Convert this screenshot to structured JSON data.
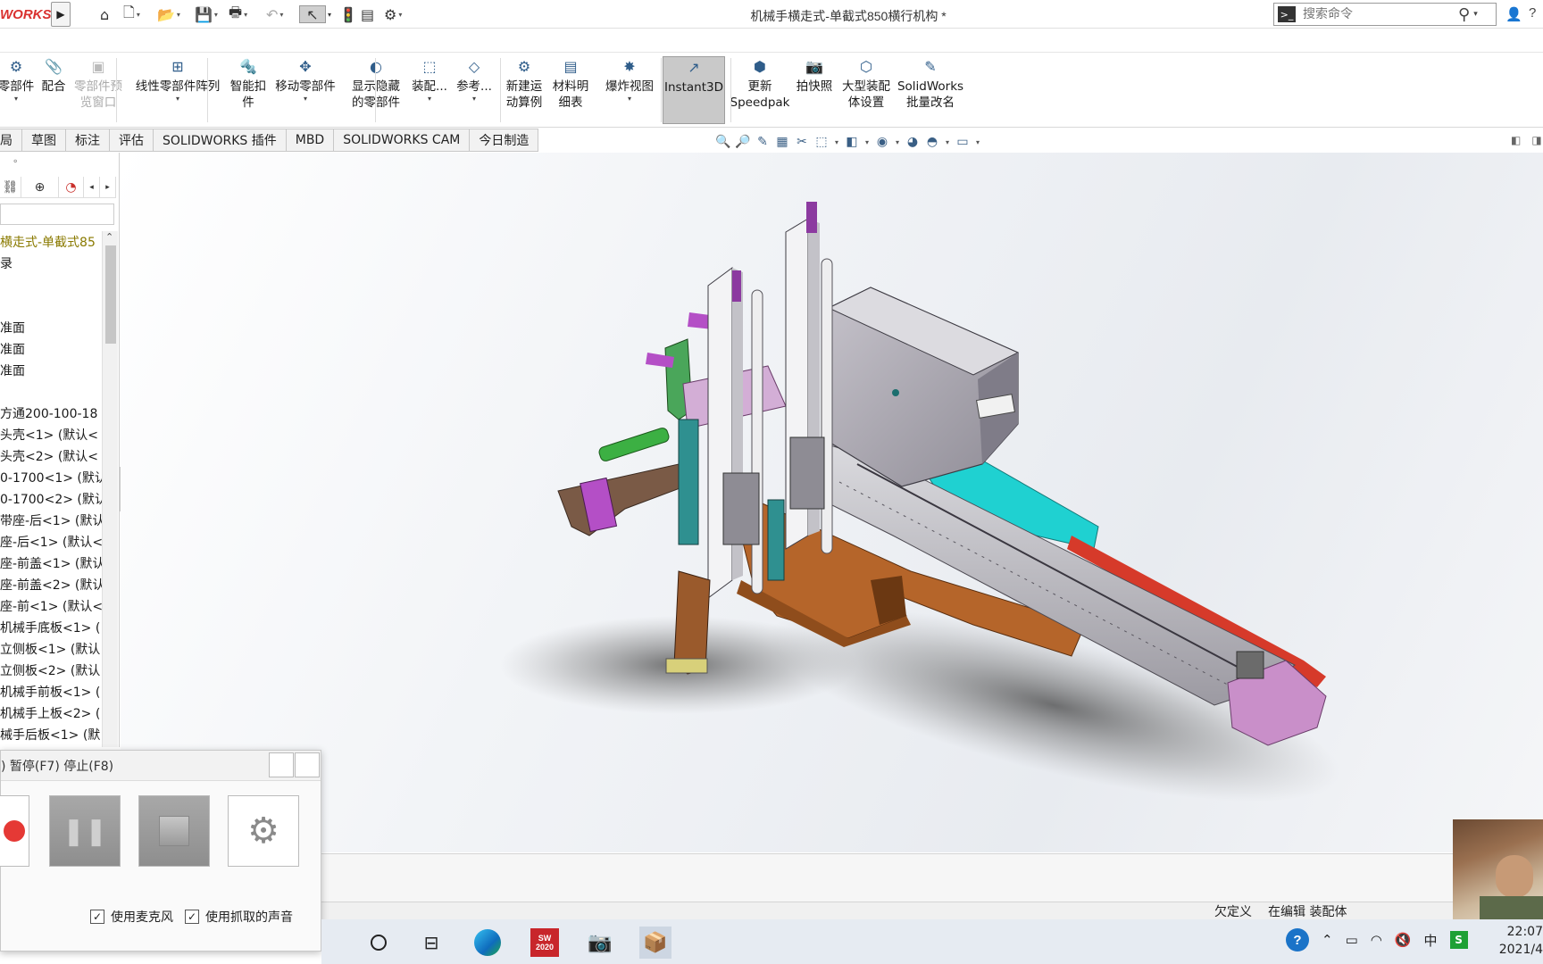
{
  "app": {
    "logo_text": "WORKS",
    "document_title": "机械手横走式-单截式850横行机构 *",
    "search_placeholder": "搜索命令",
    "help_label": "?"
  },
  "ribbon": {
    "buttons": [
      {
        "line1": "零部件",
        "line2": "",
        "dropdown": true,
        "icon": "insert-component-icon",
        "disabled": false
      },
      {
        "line1": "配合",
        "line2": "",
        "dropdown": false,
        "icon": "mate-icon",
        "disabled": false
      },
      {
        "line1": "零部件预",
        "line2": "览窗口",
        "dropdown": false,
        "icon": "component-preview-icon",
        "disabled": true
      },
      {
        "line1": "线性零部件阵列",
        "line2": "",
        "dropdown": true,
        "icon": "linear-pattern-icon",
        "disabled": false
      },
      {
        "line1": "智能扣",
        "line2": "件",
        "dropdown": false,
        "icon": "smart-fastener-icon",
        "disabled": false
      },
      {
        "line1": "移动零部件",
        "line2": "",
        "dropdown": true,
        "icon": "move-component-icon",
        "disabled": false
      },
      {
        "line1": "显示隐藏",
        "line2": "的零部件",
        "dropdown": false,
        "icon": "show-hidden-icon",
        "disabled": false
      },
      {
        "line1": "装配...",
        "line2": "",
        "dropdown": true,
        "icon": "assembly-features-icon",
        "disabled": false
      },
      {
        "line1": "参考...",
        "line2": "",
        "dropdown": true,
        "icon": "reference-geometry-icon",
        "disabled": false
      },
      {
        "line1": "新建运",
        "line2": "动算例",
        "dropdown": false,
        "icon": "motion-study-icon",
        "disabled": false
      },
      {
        "line1": "材料明",
        "line2": "细表",
        "dropdown": false,
        "icon": "bom-icon",
        "disabled": false
      },
      {
        "line1": "爆炸视图",
        "line2": "",
        "dropdown": true,
        "icon": "exploded-view-icon",
        "disabled": false
      },
      {
        "line1": "Instant3D",
        "line2": "",
        "dropdown": false,
        "icon": "instant3d-icon",
        "disabled": false,
        "active": true
      },
      {
        "line1": "更新",
        "line2": "Speedpak",
        "dropdown": false,
        "icon": "speedpak-icon",
        "disabled": false
      },
      {
        "line1": "拍快照",
        "line2": "",
        "dropdown": false,
        "icon": "snapshot-icon",
        "disabled": false
      },
      {
        "line1": "大型装配",
        "line2": "体设置",
        "dropdown": false,
        "icon": "large-assembly-icon",
        "disabled": false
      },
      {
        "line1": "SolidWorks",
        "line2": "批量改名",
        "dropdown": false,
        "icon": "batch-rename-icon",
        "disabled": false
      }
    ]
  },
  "tabs": [
    "局",
    "草图",
    "标注",
    "评估",
    "SOLIDWORKS 插件",
    "MBD",
    "SOLIDWORKS CAM",
    "今日制造"
  ],
  "tree": {
    "items": [
      "横走式-单截式85",
      "录",
      "",
      "",
      "准面",
      "准面",
      "准面",
      "",
      "方通200-100-18",
      "头壳<1> (默认<",
      "头壳<2> (默认<",
      "0-1700<1> (默认",
      "0-1700<2> (默认",
      "带座-后<1> (默认",
      "座-后<1> (默认<",
      "座-前盖<1> (默认",
      "座-前盖<2> (默认",
      "座-前<1> (默认<",
      "机械手底板<1> (",
      "立侧板<1> (默认",
      "立侧板<2> (默认",
      "机械手前板<1> (",
      "机械手上板<2> (",
      "械手后板<1> (默"
    ]
  },
  "recorder": {
    "top_text": ") 暂停(F7) 停止(F8)",
    "mic_label": "使用麦克风",
    "capture_sound_label": "使用抓取的声音",
    "mic_checked": "✓",
    "sound_checked": "✓"
  },
  "status": {
    "state": "欠定义",
    "mode": "在编辑 装配体"
  },
  "taskbar": {
    "clock_time": "22:07",
    "clock_date": "2021/4",
    "ime": "中",
    "sw_badge": "SW 2020"
  },
  "colors": {
    "logo_red": "#d9312f",
    "ribbon_active": "#c9c9c9",
    "model_gray": "#a9a6ae",
    "model_orange": "#b5652a",
    "model_purple": "#c98fc9",
    "model_cyan": "#1fd1d1",
    "model_green": "#3cb043"
  }
}
